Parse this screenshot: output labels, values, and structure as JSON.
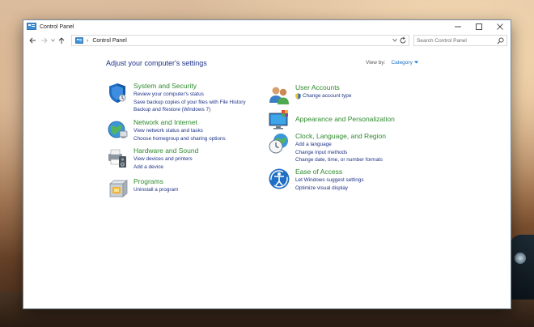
{
  "window": {
    "title": "Control Panel"
  },
  "address": {
    "breadcrumb": "Control Panel"
  },
  "search": {
    "placeholder": "Search Control Panel"
  },
  "main": {
    "heading": "Adjust your computer's settings",
    "view_by_label": "View by:",
    "view_by_value": "Category"
  },
  "categories": [
    {
      "title": "System and Security",
      "icon": "shield-icon",
      "links": [
        "Review your computer's status",
        "Save backup copies of your files with File History",
        "Backup and Restore (Windows 7)"
      ]
    },
    {
      "title": "Network and Internet",
      "icon": "globe-network-icon",
      "links": [
        "View network status and tasks",
        "Choose homegroup and sharing options"
      ]
    },
    {
      "title": "Hardware and Sound",
      "icon": "printer-speaker-icon",
      "links": [
        "View devices and printers",
        "Add a device"
      ]
    },
    {
      "title": "Programs",
      "icon": "programs-box-icon",
      "links": [
        "Uninstall a program"
      ]
    },
    {
      "title": "User Accounts",
      "icon": "users-icon",
      "links": [
        "Change account type"
      ]
    },
    {
      "title": "Appearance and Personalization",
      "icon": "display-palette-icon",
      "links": []
    },
    {
      "title": "Clock, Language, and Region",
      "icon": "clock-globe-icon",
      "links": [
        "Add a language",
        "Change input methods",
        "Change date, time, or number formats"
      ]
    },
    {
      "title": "Ease of Access",
      "icon": "ease-of-access-icon",
      "links": [
        "Let Windows suggest settings",
        "Optimize visual display"
      ]
    }
  ],
  "colors": {
    "heading": "#1e3287",
    "category_title": "#2e8b2e",
    "link": "#1e3287",
    "accent": "#1a73c8"
  }
}
